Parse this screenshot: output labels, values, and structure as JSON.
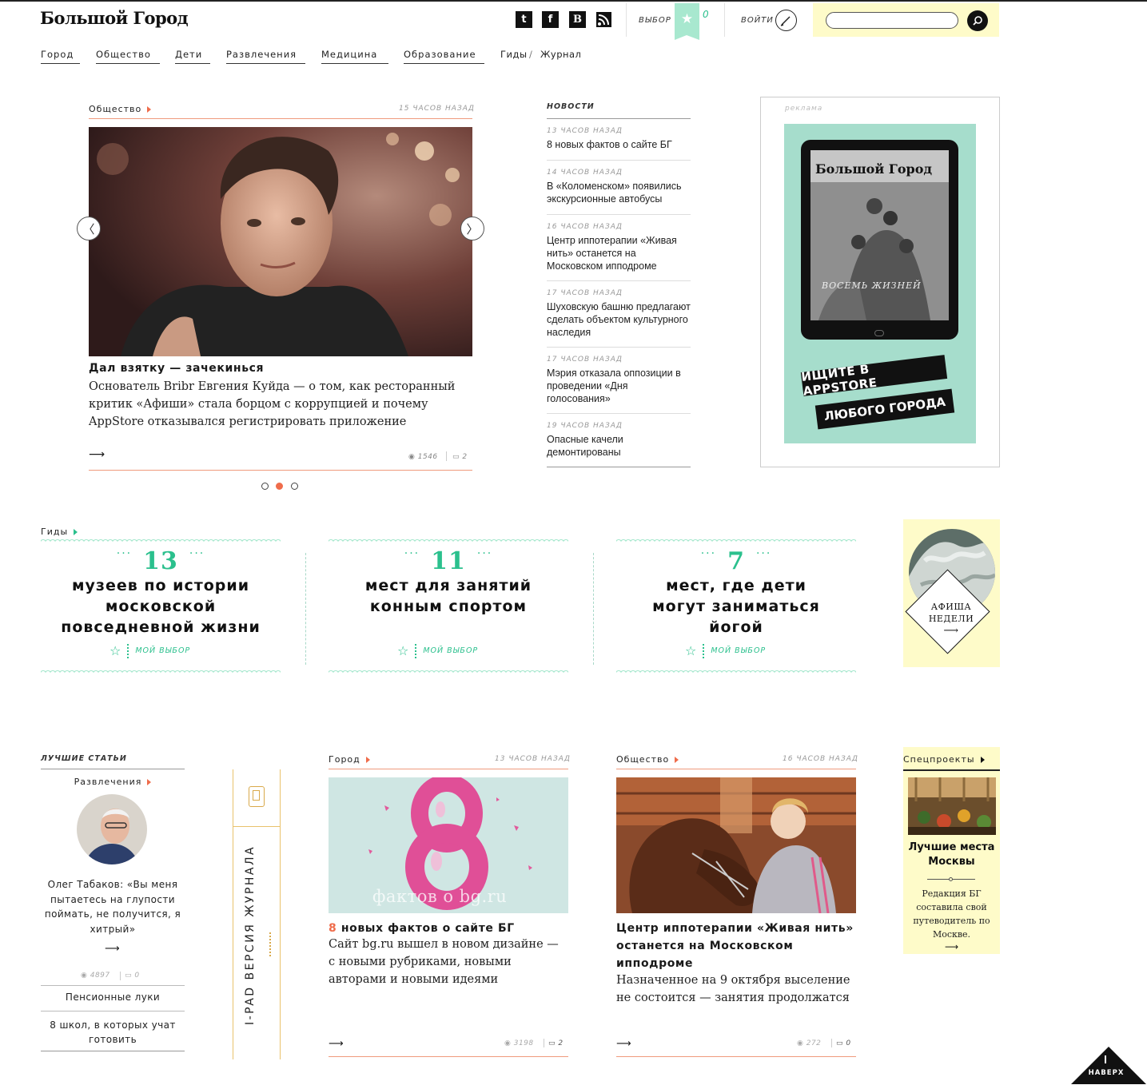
{
  "header": {
    "logo": "Большой Город",
    "social": [
      {
        "name": "twitter-icon",
        "glyph": "t"
      },
      {
        "name": "facebook-icon",
        "glyph": "f"
      },
      {
        "name": "vkontakte-icon",
        "glyph": "B"
      },
      {
        "name": "rss-icon",
        "glyph": "◥"
      }
    ],
    "vybor_label": "ВЫБОР",
    "star_count": "0",
    "login_label": "ВОЙТИ",
    "search_placeholder": ""
  },
  "nav": {
    "items": [
      "Город",
      "Общество",
      "Дети",
      "Развлечения",
      "Медицина",
      "Образование"
    ],
    "extra": [
      "Гиды",
      "/",
      "Журнал"
    ]
  },
  "featured": {
    "category": "Общество",
    "time": "15 ЧАСОВ НАЗАД",
    "title": "Дал взятку — зачекинься",
    "desc": "Основатель Bribr Евгения Куйда — о том, как ресторанный критик «Афиши» стала борцом с коррупцией и почему AppStore отказывался регистрировать приложение",
    "views": "1546",
    "comments": "2",
    "active_slide": 2
  },
  "news": {
    "title": "НОВОСТИ",
    "items": [
      {
        "time": "13 ЧАСОВ НАЗАД",
        "text": "8 новых фактов о сайте БГ"
      },
      {
        "time": "14 ЧАСОВ НАЗАД",
        "text": "В «Коломенском» появились экскурсионные автобусы"
      },
      {
        "time": "16 ЧАСОВ НАЗАД",
        "text": "Центр иппотерапии «Живая нить» останется на Московском ипподроме"
      },
      {
        "time": "17 ЧАСОВ НАЗАД",
        "text": "Шуховскую башню предлагают сделать объектом культурного наследия"
      },
      {
        "time": "17 ЧАСОВ НАЗАД",
        "text": "Мэрия отказала оппозиции в проведении «Дня голосования»"
      },
      {
        "time": "19 ЧАСОВ НАЗАД",
        "text": "Опасные качели демонтированы"
      }
    ]
  },
  "ad": {
    "label": "реклама",
    "magazine": "Большой Город",
    "cover_line": "ВОСЕМЬ ЖИЗНЕЙ",
    "line1": "ИЩИТЕ В APPSTORE",
    "line2": "ЛЮБОГО ГОРОДА"
  },
  "guides": {
    "label": "Гиды",
    "my_choice": "МОЙ ВЫБОР",
    "items": [
      {
        "num": "13",
        "title": "музеев по истории московской повседневной жизни"
      },
      {
        "num": "11",
        "title": "мест для занятий конным спортом"
      },
      {
        "num": "7",
        "title": "мест, где дети могут заниматься йогой"
      }
    ],
    "afisha_line1": "АФИША",
    "afisha_line2": "НЕДЕЛИ"
  },
  "best": {
    "title": "ЛУЧШИЕ СТАТЬИ",
    "category": "Развлечения",
    "quote": "Олег Табаков: «Вы меня пытаетесь на глупости поймать, не получится, я хитрый»",
    "views": "4897",
    "comments": "0",
    "links": [
      "Пенсионные луки",
      "8 школ, в которых учат готовить"
    ]
  },
  "ipad": {
    "label": "I-PAD ВЕРСИЯ ЖУРНАЛА"
  },
  "card1": {
    "category": "Город",
    "time": "13 ЧАСОВ НАЗАД",
    "img_caption": "фактов о bg.ru",
    "title_num": "8",
    "title": "новых фактов о сайте БГ",
    "desc": "Сайт bg.ru вышел в новом дизайне — с новыми рубриками, новыми авторами и новыми идеями",
    "views": "3198",
    "comments": "2"
  },
  "card2": {
    "category": "Общество",
    "time": "16 ЧАСОВ НАЗАД",
    "title": "Центр иппотерапии «Живая нить» останется на Московском ипподроме",
    "desc": "Назначенное на 9 октября выселение не состоится — занятия продолжатся",
    "views": "272",
    "comments": "0"
  },
  "special": {
    "label": "Спецпроекты",
    "title": "Лучшие места Москвы",
    "desc": "Редакция БГ составила свой путеводитель по Москве."
  },
  "top_button": "НАВЕРХ",
  "colors": {
    "accent": "#ef6c4b",
    "green": "#2bc08d",
    "mint": "#a8e8cf",
    "yellow": "#fefbc9"
  }
}
